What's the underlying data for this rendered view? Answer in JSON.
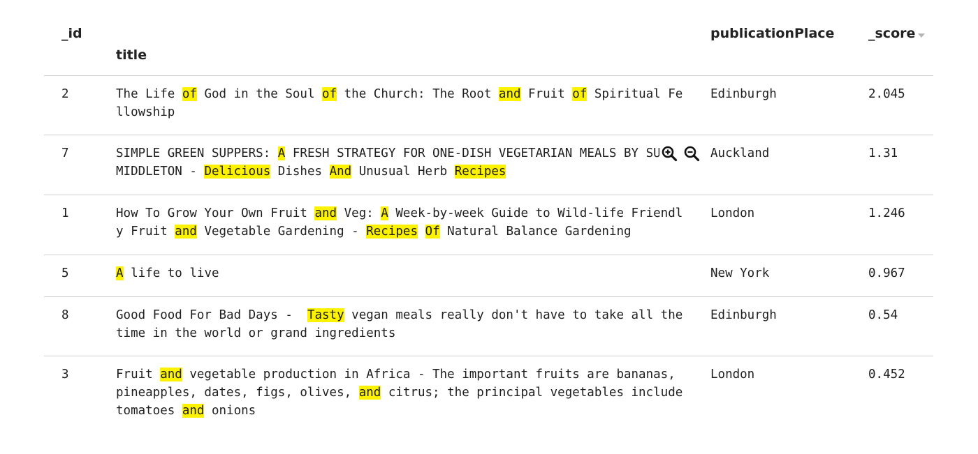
{
  "columns": {
    "id": "_id",
    "title": "title",
    "publication_place": "publicationPlace",
    "score": "_score"
  },
  "rows": [
    {
      "id": "2",
      "title": [
        {
          "t": "The Life "
        },
        {
          "t": "of",
          "hl": true
        },
        {
          "t": " God in the Soul "
        },
        {
          "t": "of",
          "hl": true
        },
        {
          "t": " the Church: The Root "
        },
        {
          "t": "and",
          "hl": true
        },
        {
          "t": " Fruit "
        },
        {
          "t": "of",
          "hl": true
        },
        {
          "t": " Spiritual Fellowship"
        }
      ],
      "publication_place": "Edinburgh",
      "score": "2.045"
    },
    {
      "id": "7",
      "title": [
        {
          "t": "SIMPLE GREEN SUPPERS: "
        },
        {
          "t": "A",
          "hl": true
        },
        {
          "t": " FRESH STRATEGY FOR ONE-DISH VEGETARIAN MEALS BY SUSIE MIDDLETON - "
        },
        {
          "t": "Delicious",
          "hl": true
        },
        {
          "t": " Dishes "
        },
        {
          "t": "And",
          "hl": true
        },
        {
          "t": " Unusual Herb "
        },
        {
          "t": "Recipes",
          "hl": true
        }
      ],
      "publication_place": "Auckland",
      "score": "1.31",
      "tools": {
        "zoom_in_icon": "zoom-in-icon",
        "zoom_out_icon": "zoom-out-icon"
      }
    },
    {
      "id": "1",
      "title": [
        {
          "t": "How To Grow Your Own Fruit "
        },
        {
          "t": "and",
          "hl": true
        },
        {
          "t": " Veg: "
        },
        {
          "t": "A",
          "hl": true
        },
        {
          "t": " Week-by-week Guide to Wild-life Friendly Fruit "
        },
        {
          "t": "and",
          "hl": true
        },
        {
          "t": " Vegetable Gardening - "
        },
        {
          "t": "Recipes",
          "hl": true
        },
        {
          "t": " "
        },
        {
          "t": "Of",
          "hl": true
        },
        {
          "t": " Natural Balance Gardening"
        }
      ],
      "publication_place": "London",
      "score": "1.246"
    },
    {
      "id": "5",
      "title": [
        {
          "t": "A",
          "hl": true
        },
        {
          "t": " life to live"
        }
      ],
      "publication_place": "New York",
      "score": "0.967"
    },
    {
      "id": "8",
      "title": [
        {
          "t": "Good Food For Bad Days -  "
        },
        {
          "t": "Tasty",
          "hl": true
        },
        {
          "t": " vegan meals really don't have to take all the time in the world or grand ingredients"
        }
      ],
      "publication_place": "Edinburgh",
      "score": "0.54"
    },
    {
      "id": "3",
      "title": [
        {
          "t": "Fruit "
        },
        {
          "t": "and",
          "hl": true
        },
        {
          "t": " vegetable production in Africa - The important fruits are bananas, pineapples, dates, figs, olives, "
        },
        {
          "t": "and",
          "hl": true
        },
        {
          "t": " citrus; the principal vegetables include tomatoes "
        },
        {
          "t": "and",
          "hl": true
        },
        {
          "t": " onions"
        }
      ],
      "publication_place": "London",
      "score": "0.452"
    }
  ],
  "colors": {
    "highlight": "#fdf200",
    "divider": "#cfcfcf"
  }
}
